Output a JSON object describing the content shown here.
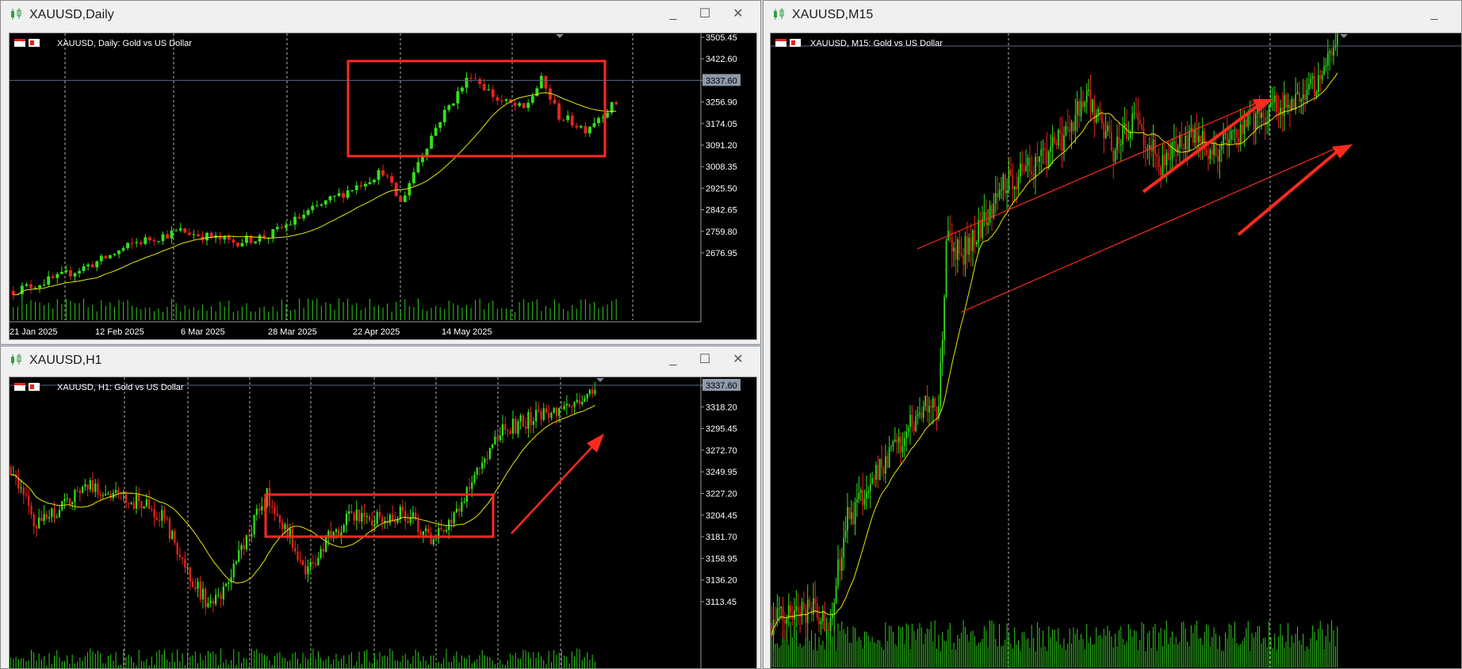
{
  "windows": {
    "daily": {
      "title": "XAUUSD,Daily",
      "header": "XAUUSD, Daily:  Gold vs US Dollar",
      "price_labels": [
        "3505.45",
        "3422.60",
        "3337.60",
        "3256.90",
        "3174.05",
        "3091.20",
        "3008.35",
        "2925.50",
        "2842.65",
        "2759.80",
        "2676.95"
      ],
      "current_price": "3337.60",
      "date_labels": [
        "21 Jan 2025",
        "12 Feb 2025",
        "6 Mar 2025",
        "28 Mar 2025",
        "22 Apr 2025",
        "14 May 2025"
      ]
    },
    "h1": {
      "title": "XAUUSD,H1",
      "header": "XAUUSD, H1:  Gold vs US Dollar",
      "price_labels": [
        "3337.60",
        "3318.20",
        "3295.45",
        "3272.70",
        "3249.95",
        "3227.20",
        "3204.45",
        "3181.70",
        "3158.95",
        "3136.20",
        "3113.45"
      ],
      "current_price": "3337.60"
    },
    "m15": {
      "title": "XAUUSD,M15",
      "header": "XAUUSD, M15:  Gold vs US Dollar"
    }
  },
  "window_buttons": {
    "minimize": "_",
    "maximize": "☐",
    "close": "✕"
  },
  "colors": {
    "bull": "#33e01a",
    "bear": "#e8231a",
    "ma": "#e6e600",
    "volume": "#2ecc1a",
    "annotation": "#ff2a1f",
    "grid": "#b4b4b4",
    "price_tag_bg": "#8e9aab"
  },
  "chart_data": [
    {
      "type": "candlestick",
      "symbol": "XAUUSD",
      "timeframe": "Daily",
      "title": "XAUUSD, Daily:  Gold vs US Dollar",
      "x_tick_labels": [
        "21 Jan 2025",
        "12 Feb 2025",
        "6 Mar 2025",
        "28 Mar 2025",
        "22 Apr 2025",
        "14 May 2025"
      ],
      "y_ticks": [
        3505.45,
        3422.6,
        3337.6,
        3256.9,
        3174.05,
        3091.2,
        3008.35,
        2925.5,
        2842.65,
        2759.8,
        2676.95
      ],
      "ylim": [
        2640,
        3545
      ],
      "current_price": 3337.6,
      "close_anchors": [
        [
          0,
          2750
        ],
        [
          10,
          2790
        ],
        [
          20,
          2845
        ],
        [
          28,
          2900
        ],
        [
          38,
          2935
        ],
        [
          50,
          2900
        ],
        [
          58,
          2920
        ],
        [
          68,
          3000
        ],
        [
          76,
          3060
        ],
        [
          84,
          3120
        ],
        [
          88,
          3020
        ],
        [
          92,
          3150
        ],
        [
          97,
          3280
        ],
        [
          104,
          3420
        ],
        [
          110,
          3340
        ],
        [
          116,
          3310
        ],
        [
          120,
          3400
        ],
        [
          124,
          3290
        ],
        [
          130,
          3250
        ],
        [
          134,
          3300
        ],
        [
          137,
          3330
        ]
      ],
      "indicators": [
        "moving average",
        "volume"
      ]
    },
    {
      "type": "candlestick",
      "symbol": "XAUUSD",
      "timeframe": "H1",
      "title": "XAUUSD, H1:  Gold vs US Dollar",
      "y_ticks": [
        3337.6,
        3318.2,
        3295.45,
        3272.7,
        3249.95,
        3227.2,
        3204.45,
        3181.7,
        3158.95,
        3136.2,
        3113.45
      ],
      "ylim": [
        3098,
        3346
      ],
      "current_price": 3337.6,
      "close_anchors": [
        [
          0,
          3270
        ],
        [
          10,
          3220
        ],
        [
          20,
          3235
        ],
        [
          30,
          3255
        ],
        [
          40,
          3245
        ],
        [
          50,
          3240
        ],
        [
          60,
          3225
        ],
        [
          68,
          3185
        ],
        [
          78,
          3150
        ],
        [
          84,
          3165
        ],
        [
          92,
          3210
        ],
        [
          100,
          3245
        ],
        [
          108,
          3215
        ],
        [
          116,
          3180
        ],
        [
          124,
          3210
        ],
        [
          134,
          3230
        ],
        [
          144,
          3225
        ],
        [
          154,
          3230
        ],
        [
          164,
          3210
        ],
        [
          174,
          3230
        ],
        [
          182,
          3270
        ],
        [
          192,
          3300
        ],
        [
          202,
          3310
        ],
        [
          212,
          3315
        ],
        [
          222,
          3325
        ],
        [
          228,
          3340
        ]
      ],
      "indicators": [
        "moving average",
        "volume"
      ]
    },
    {
      "type": "candlestick",
      "symbol": "XAUUSD",
      "timeframe": "M15",
      "title": "XAUUSD, M15:  Gold vs US Dollar",
      "ylim": [
        3130,
        3345
      ],
      "close_anchors": [
        [
          0,
          3145
        ],
        [
          20,
          3150
        ],
        [
          30,
          3145
        ],
        [
          40,
          3180
        ],
        [
          60,
          3200
        ],
        [
          72,
          3210
        ],
        [
          80,
          3220
        ],
        [
          88,
          3215
        ],
        [
          92,
          3275
        ],
        [
          100,
          3270
        ],
        [
          110,
          3280
        ],
        [
          124,
          3295
        ],
        [
          140,
          3300
        ],
        [
          154,
          3310
        ],
        [
          166,
          3325
        ],
        [
          180,
          3305
        ],
        [
          192,
          3315
        ],
        [
          206,
          3300
        ],
        [
          220,
          3310
        ],
        [
          234,
          3305
        ],
        [
          252,
          3315
        ],
        [
          266,
          3320
        ],
        [
          280,
          3325
        ],
        [
          290,
          3330
        ],
        [
          298,
          3342
        ]
      ],
      "indicators": [
        "moving average",
        "volume"
      ]
    }
  ]
}
